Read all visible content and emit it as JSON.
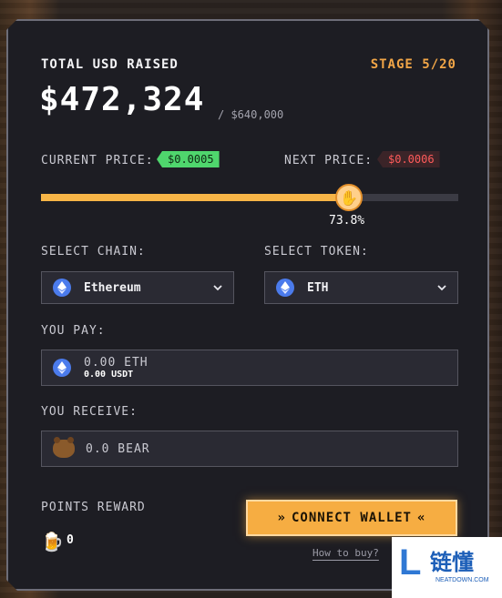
{
  "header": {
    "title": "TOTAL USD RAISED",
    "stage": "STAGE 5/20",
    "raised": "$472,324",
    "target": "/ $640,000"
  },
  "price": {
    "current_label": "CURRENT PRICE:",
    "current_value": "$0.0005",
    "next_label": "NEXT PRICE:",
    "next_value": "$0.0006"
  },
  "progress": {
    "fraction": 0.738,
    "label": "73.8%"
  },
  "chain": {
    "label": "SELECT CHAIN:",
    "selected": "Ethereum"
  },
  "token": {
    "label": "SELECT TOKEN:",
    "selected": "ETH"
  },
  "pay": {
    "label": "YOU PAY:",
    "amount": "0.00 ETH",
    "usdt": "0.00 USDT"
  },
  "receive": {
    "label": "YOU RECEIVE:",
    "amount": "0.0 BEAR"
  },
  "points": {
    "label": "POINTS REWARD",
    "value": "0"
  },
  "actions": {
    "connect": "CONNECT WALLET",
    "howto": "How to buy?"
  },
  "watermark": {
    "glyph": "L",
    "text": "链懂",
    "sub": "NEATDOWN.COM"
  },
  "colors": {
    "accent": "#f6ad42",
    "green": "#4fd66d",
    "red": "#ff5b5b",
    "eth": "#4b7bec"
  }
}
